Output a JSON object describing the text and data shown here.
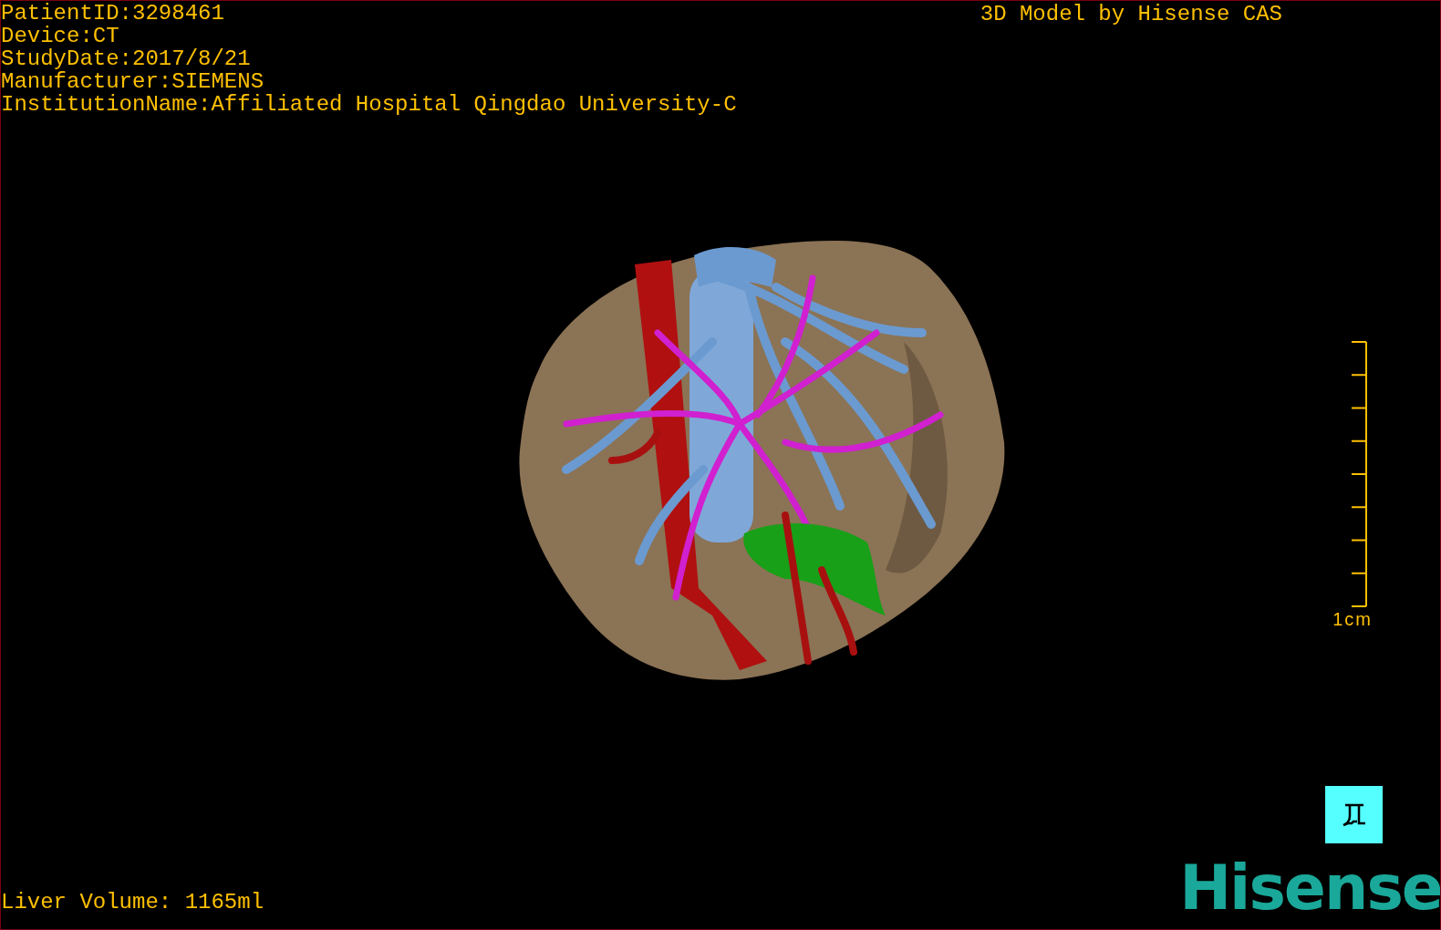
{
  "info": [
    "PatientID:3298461",
    "Device:CT",
    "StudyDate:2017/8/21",
    "Manufacturer:SIEMENS",
    "InstitutionName:Affiliated Hospital Qingdao University-C"
  ],
  "title": "3D Model by Hisense CAS",
  "scale_bar": {
    "label": "1cm"
  },
  "volume": "Liver Volume: 1165ml",
  "logo": "Hisense"
}
